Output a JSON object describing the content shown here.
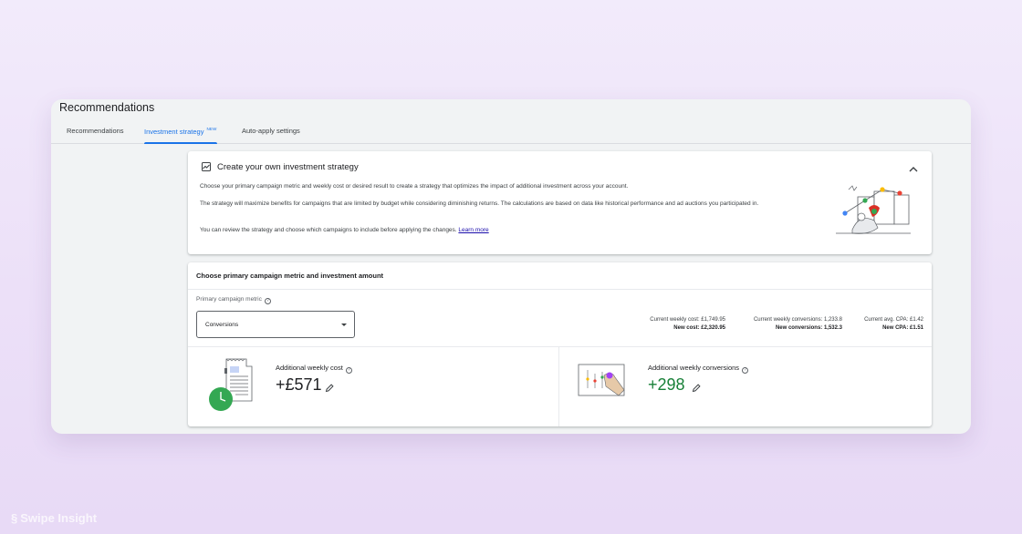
{
  "page": {
    "title": "Recommendations"
  },
  "tabs": [
    {
      "label": "Recommendations",
      "active": false
    },
    {
      "label": "Investment strategy",
      "active": true,
      "badge": "NEW"
    },
    {
      "label": "Auto-apply settings",
      "active": false
    }
  ],
  "strategy_card": {
    "title": "Create your own investment strategy",
    "icon": "chart-box-icon",
    "collapse_icon": "chevron-up-icon",
    "paragraph1": "Choose your primary campaign metric and weekly cost or desired result to create a strategy that optimizes the impact of additional investment across your account.",
    "paragraph2": "The strategy will maximize benefits for campaigns that are limited by budget while considering diminishing returns. The calculations are based on data like historical performance and ad auctions you participated in.",
    "paragraph3": "You can review the strategy and choose which campaigns to include before applying the changes.",
    "learn_more": "Learn more"
  },
  "metric_card": {
    "heading": "Choose primary campaign metric and investment amount",
    "metric_label": "Primary campaign metric",
    "selected_metric": "Conversions",
    "stats": {
      "weekly_cost_current": "Current weekly cost: £1,749.95",
      "weekly_cost_new": "New cost: £2,320.95",
      "conversions_current": "Current weekly conversions: 1,233.8",
      "conversions_new": "New conversions: 1,532.3",
      "cpa_current": "Current avg. CPA: £1.42",
      "cpa_new": "New CPA: £1.51"
    },
    "additional_cost": {
      "label": "Additional weekly cost",
      "value": "+£571"
    },
    "additional_conversions": {
      "label": "Additional weekly conversions",
      "value": "+298"
    }
  },
  "watermark": "Swipe Insight",
  "colors": {
    "accent": "#1a73e8",
    "positive": "#188038",
    "link": "#1a0dab",
    "background": "#ede3f8"
  }
}
